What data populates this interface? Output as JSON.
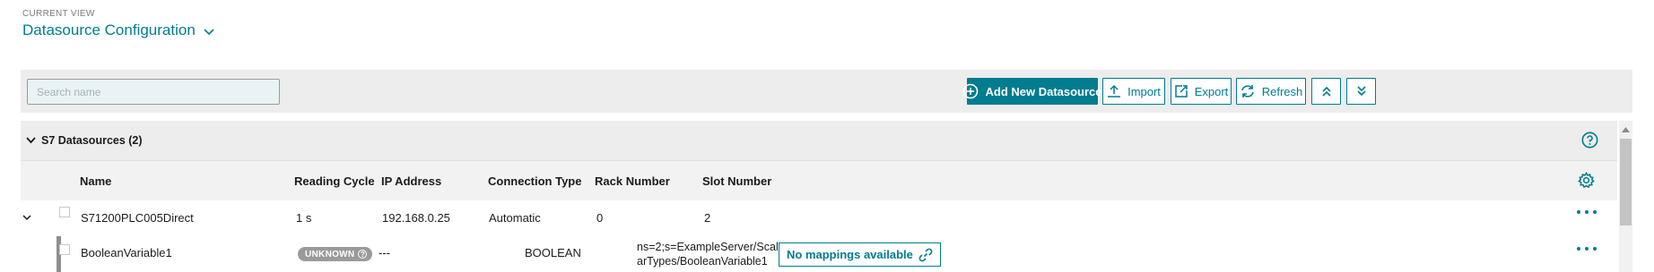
{
  "view": {
    "caption": "CURRENT VIEW",
    "title": "Datasource Configuration"
  },
  "toolbar": {
    "search_placeholder": "Search name",
    "add_label": "Add New Datasource",
    "import_label": "Import",
    "export_label": "Export",
    "refresh_label": "Refresh"
  },
  "group": {
    "title": "S7 Datasources (2)"
  },
  "columns": {
    "name": "Name",
    "reading_cycle": "Reading Cycle",
    "ip_address": "IP Address",
    "connection_type": "Connection Type",
    "rack_number": "Rack Number",
    "slot_number": "Slot Number"
  },
  "rows": [
    {
      "name": "S71200PLC005Direct",
      "reading_cycle": "1 s",
      "ip_address": "192.168.0.25",
      "connection_type": "Automatic",
      "rack_number": "0",
      "slot_number": "2"
    }
  ],
  "child_rows": [
    {
      "name": "BooleanVariable1",
      "status": "UNKNOWN",
      "value": "---",
      "data_type": "BOOLEAN",
      "node_id": "ns=2;s=ExampleServer/ScalarTypes/BooleanVariable1",
      "mapping_label": "No mappings available"
    }
  ],
  "colors": {
    "accent": "#007c8f",
    "header_bg": "#ededed",
    "badge_bg": "#9a9a9a"
  }
}
